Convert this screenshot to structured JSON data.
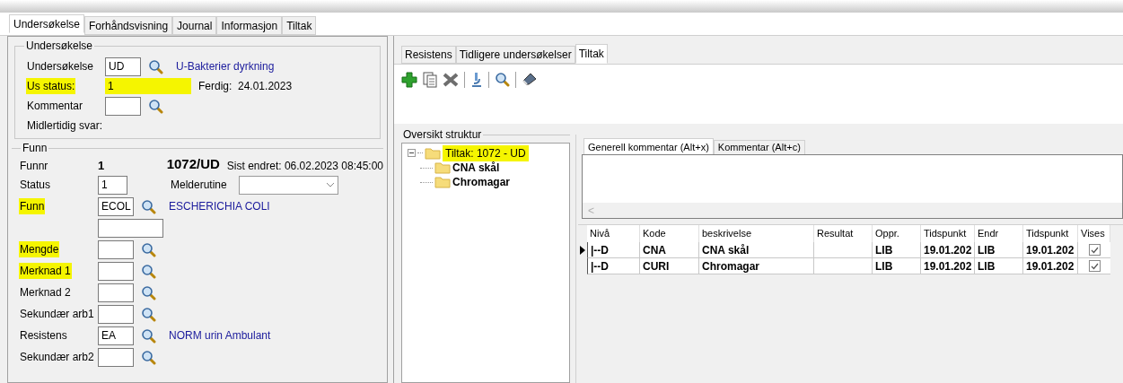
{
  "main_tabs": [
    {
      "label": "Undersøkelse",
      "selected": true
    },
    {
      "label": "Forhåndsvisning",
      "selected": false
    },
    {
      "label": "Journal",
      "selected": false
    },
    {
      "label": "Informasjon",
      "selected": false
    },
    {
      "label": "Tiltak",
      "selected": false
    }
  ],
  "undersokelse": {
    "legend": "Undersøkelse",
    "rows": [
      {
        "kind": "input",
        "label": "Undersøkelse",
        "value": "UD",
        "link": "U-Bakterier dyrkning",
        "highlighted": false
      },
      {
        "kind": "text",
        "label": "Us status:",
        "value": "1",
        "note": "Ferdig:  24.01.2023",
        "highlighted": true
      },
      {
        "kind": "input",
        "label": "Kommentar",
        "highlighted": false
      },
      {
        "kind": "label",
        "label": "Midlertidig svar:",
        "highlighted": false
      }
    ]
  },
  "funn": {
    "legend": "Funn",
    "rows": [
      {
        "kind": "funnr",
        "label": "Funnr",
        "value": "1",
        "code": "1072/UD",
        "note": "Sist endret: 06.02.2023 08:45:00",
        "highlighted": false
      },
      {
        "kind": "status",
        "label": "Status",
        "value": "1",
        "select_label": "Melderutine",
        "highlighted": false
      },
      {
        "kind": "input",
        "label": "Funn",
        "value": "ECOL",
        "link": "ESCHERICHIA COLI",
        "highlighted": true
      },
      {
        "kind": "wide"
      },
      {
        "kind": "input",
        "label": "Mengde",
        "highlighted": true
      },
      {
        "kind": "input",
        "label": "Merknad 1",
        "highlighted": true
      },
      {
        "kind": "input",
        "label": "Merknad 2",
        "highlighted": false
      },
      {
        "kind": "input",
        "label": "Sekundær arb1",
        "highlighted": false
      },
      {
        "kind": "input",
        "label": "Resistens",
        "value": "EA",
        "link": "NORM urin Ambulant",
        "highlighted": false
      },
      {
        "kind": "input",
        "label": "Sekundær arb2",
        "highlighted": false
      }
    ]
  },
  "right_tabs": [
    {
      "label": "Resistens",
      "selected": false
    },
    {
      "label": "Tidligere undersøkelser",
      "selected": false
    },
    {
      "label": "Tiltak",
      "selected": true
    }
  ],
  "toolbar": [
    {
      "kind": "add"
    },
    {
      "kind": "copy"
    },
    {
      "kind": "delete"
    },
    {
      "kind": "separator"
    },
    {
      "kind": "microscope"
    },
    {
      "kind": "separator"
    },
    {
      "kind": "search"
    },
    {
      "kind": "separator"
    },
    {
      "kind": "eraser"
    }
  ],
  "tree": {
    "legend": "Oversikt struktur",
    "root": {
      "label": "Tiltak: 1072 - UD",
      "expanded": true,
      "highlighted": true,
      "children": [
        {
          "label": "CNA skål"
        },
        {
          "label": "Chromagar"
        }
      ]
    }
  },
  "comment_tabs": [
    {
      "label": "Generell kommentar (Alt+x)",
      "selected": true
    },
    {
      "label": "Kommentar (Alt+c)",
      "selected": false
    }
  ],
  "scroll_left": "<",
  "table": {
    "columns": [
      "Nivå",
      "Kode",
      "beskrivelse",
      "Resultat",
      "Oppr.",
      "Tidspunkt",
      "Endr",
      "Tidspunkt",
      "Vises"
    ],
    "rows": [
      {
        "cells": [
          "|--D",
          "CNA",
          "CNA skål",
          "",
          "LIB",
          "19.01.202",
          "LIB",
          "19.01.202"
        ],
        "vises": true,
        "selected": true
      },
      {
        "cells": [
          "|--D",
          "CURI",
          "Chromagar",
          "",
          "LIB",
          "19.01.202",
          "LIB",
          "19.01.202"
        ],
        "vises": true,
        "selected": false
      }
    ]
  }
}
